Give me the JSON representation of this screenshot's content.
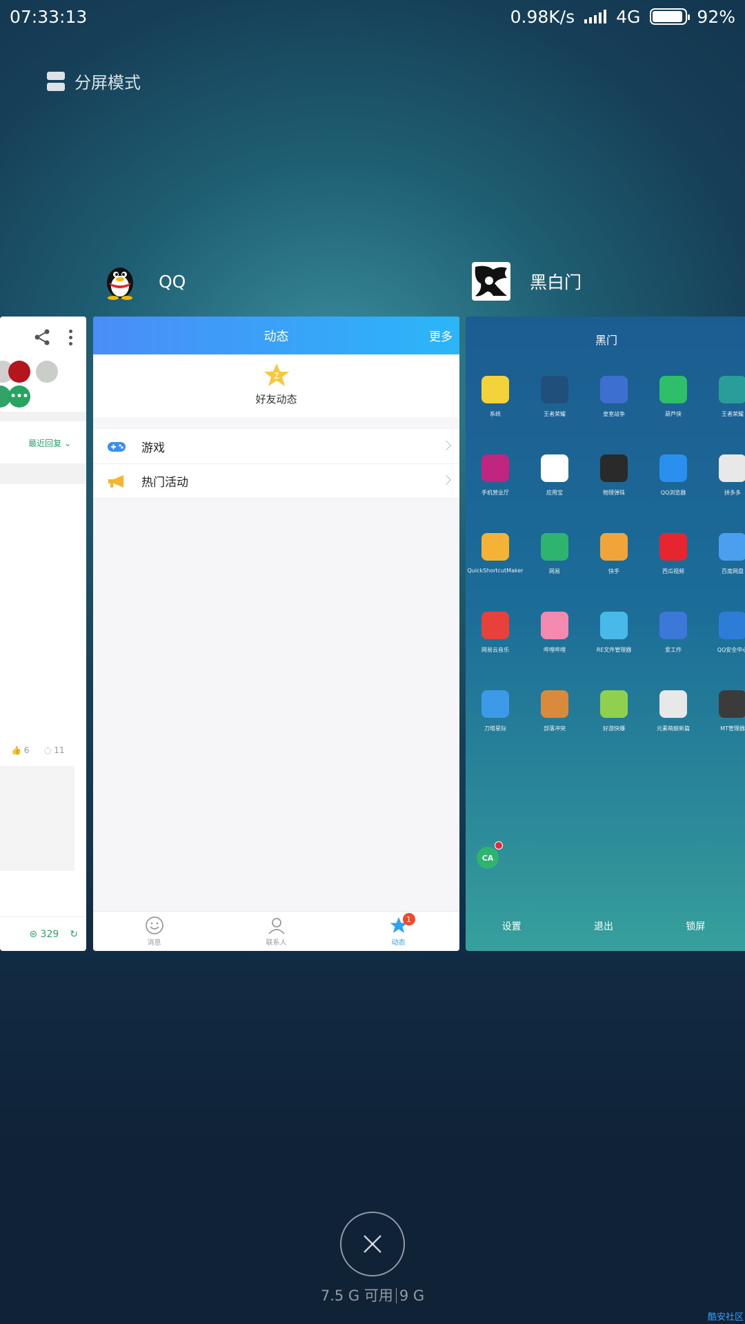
{
  "status": {
    "time": "07:33:13",
    "net_speed": "0.98K/s",
    "network": "4G",
    "battery": "92%",
    "battery_level": 0.92
  },
  "split_mode": {
    "label": "分屏模式",
    "icon": "split-screen-icon"
  },
  "apps": [
    {
      "name": "QQ",
      "icon": "qq-penguin-icon"
    },
    {
      "name": "黑白门",
      "icon": "heibaimen-icon"
    }
  ],
  "left_card": {
    "reply_label": "最近回复",
    "likes": "6",
    "comments": "11",
    "reply_count": "329"
  },
  "qq_card": {
    "title": "动态",
    "more": "更多",
    "friends_feed": "好友动态",
    "items": [
      {
        "label": "游戏",
        "icon": "gamepad-icon"
      },
      {
        "label": "热门活动",
        "icon": "megaphone-icon"
      }
    ],
    "tabs": [
      {
        "label": "消息",
        "icon": "smile-icon"
      },
      {
        "label": "联系人",
        "icon": "person-icon"
      },
      {
        "label": "动态",
        "icon": "star-icon",
        "badge": "1"
      }
    ]
  },
  "heimen_card": {
    "title": "黑门",
    "apps": [
      {
        "label": "系统",
        "color": "#f4d23c"
      },
      {
        "label": "王者荣耀",
        "color": "#1f4f7a"
      },
      {
        "label": "皇室战争",
        "color": "#3d6fd0"
      },
      {
        "label": "葫芦侠",
        "color": "#2fbf6a"
      },
      {
        "label": "王者荣耀",
        "color": "#2a9d9a"
      },
      {
        "label": "手机营业厅",
        "color": "#c02580"
      },
      {
        "label": "应用宝",
        "color": "#ffffff"
      },
      {
        "label": "物理弹珠",
        "color": "#2a2a2a"
      },
      {
        "label": "QQ浏览器",
        "color": "#2b8ff0"
      },
      {
        "label": "拼多多",
        "color": "#e8e8e8"
      },
      {
        "label": "QuickShortcutMaker",
        "color": "#f5b335"
      },
      {
        "label": "网易",
        "color": "#2eb46e"
      },
      {
        "label": "快手",
        "color": "#f0a43a"
      },
      {
        "label": "西瓜视频",
        "color": "#e6262e"
      },
      {
        "label": "百度网盘",
        "color": "#4aa0ee"
      },
      {
        "label": "网易云音乐",
        "color": "#e8403a"
      },
      {
        "label": "哔哩哔哩",
        "color": "#f58ab0"
      },
      {
        "label": "RE文件管理器",
        "color": "#48b9e8"
      },
      {
        "label": "爱工作",
        "color": "#3c78d8"
      },
      {
        "label": "QQ安全中心",
        "color": "#2d7cd6"
      },
      {
        "label": "刀塔星际",
        "color": "#3d9ae8"
      },
      {
        "label": "部落冲突",
        "color": "#d98a3a"
      },
      {
        "label": "好游快爆",
        "color": "#8fd14f"
      },
      {
        "label": "元素萌娘新篇",
        "color": "#e8e8e8"
      },
      {
        "label": "MT管理器",
        "color": "#3b3b3b"
      }
    ],
    "bottom": [
      "设置",
      "退出",
      "锁屏"
    ]
  },
  "memory": {
    "available": "7.5 G 可用",
    "total": "9 G"
  },
  "watermark": "酷安社区"
}
